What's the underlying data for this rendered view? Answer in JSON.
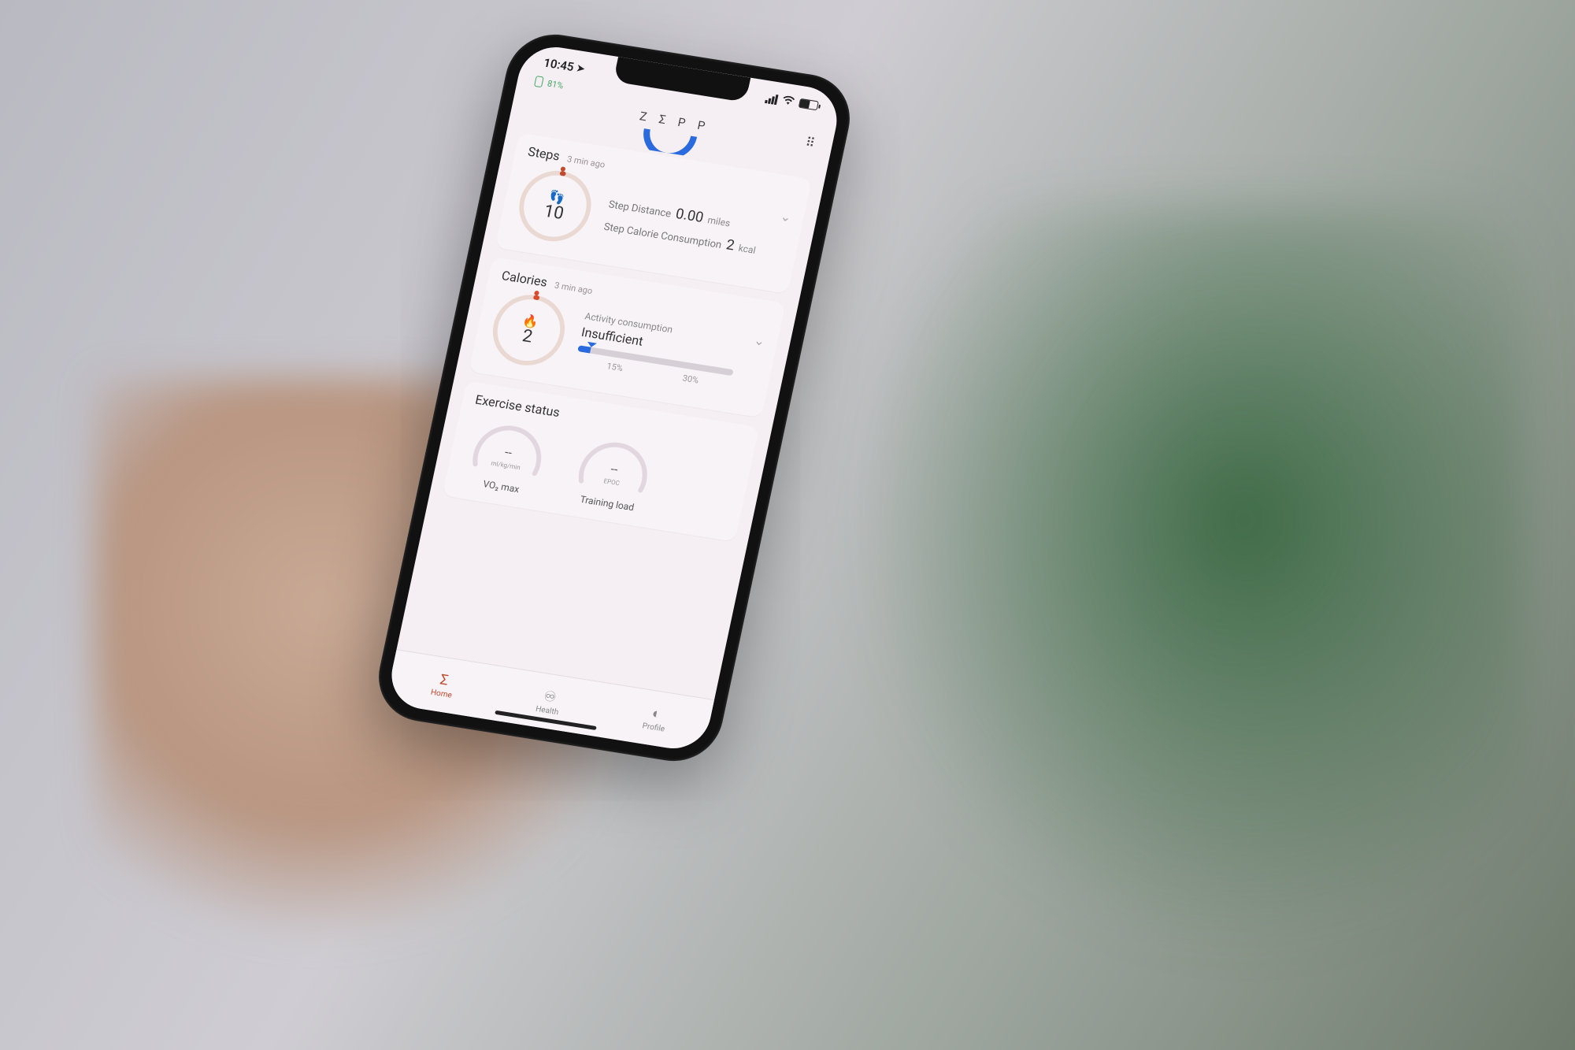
{
  "status": {
    "time": "10:45",
    "battery_pct": 55
  },
  "device": {
    "battery_label": "81%"
  },
  "brand": "Z Σ P P",
  "cards": {
    "steps": {
      "title": "Steps",
      "ago": "3 min ago",
      "count": "10",
      "distance_label": "Step Distance",
      "distance_value": "0.00",
      "distance_unit": "miles",
      "cal_label": "Step Calorie Consumption",
      "cal_value": "2",
      "cal_unit": "kcal"
    },
    "calories": {
      "title": "Calories",
      "ago": "3 min ago",
      "count": "2",
      "activity_label": "Activity consumption",
      "activity_status": "Insufficient",
      "tick1": "15%",
      "tick2": "30%"
    },
    "exercise": {
      "title": "Exercise status",
      "vo2_value": "--",
      "vo2_unit": "ml/kg/min",
      "vo2_name": "VO₂ max",
      "epoc_value": "--",
      "epoc_unit": "EPOC",
      "training_name": "Training load"
    }
  },
  "tabs": {
    "home": "Home",
    "health": "Health",
    "profile": "Profile"
  }
}
